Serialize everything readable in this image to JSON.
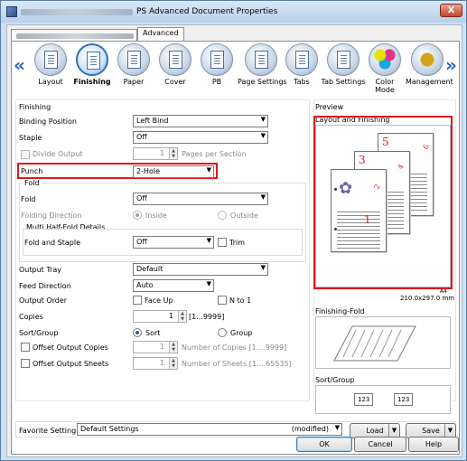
{
  "window": {
    "title": "PS Advanced Document Properties",
    "close_label": "X"
  },
  "tabs": {
    "advanced": "Advanced"
  },
  "iconbar": {
    "items": [
      {
        "label": "Layout",
        "icon": "layout-icon"
      },
      {
        "label": "Finishing",
        "icon": "finishing-icon",
        "active": true
      },
      {
        "label": "Paper",
        "icon": "paper-icon"
      },
      {
        "label": "Cover",
        "icon": "cover-icon"
      },
      {
        "label": "PB",
        "icon": "pages-per-section-icon"
      },
      {
        "label": "Page Settings",
        "icon": "page-settings-icon"
      },
      {
        "label": "Tabs",
        "icon": "tabs-icon"
      },
      {
        "label": "Tab Settings",
        "icon": "tab-settings-icon"
      },
      {
        "label": "Color Mode",
        "icon": "color-mode-icon"
      },
      {
        "label": "Management",
        "icon": "management-icon"
      }
    ]
  },
  "finishing": {
    "title": "Finishing",
    "binding_position": {
      "label": "Binding Position",
      "value": "Left Bind"
    },
    "staple": {
      "label": "Staple",
      "value": "Off"
    },
    "divide_output": {
      "label": "Divide Output",
      "value": "1",
      "unit": "Pages per Section"
    },
    "punch": {
      "label": "Punch",
      "value": "2-Hole"
    },
    "fold_group": "Fold",
    "fold": {
      "label": "Fold",
      "value": "Off"
    },
    "folding_direction": {
      "label": "Folding Direction",
      "inside": "Inside",
      "outside": "Outside"
    },
    "multi_half_fold": "Multi Half-Fold Details",
    "fold_and_staple": {
      "label": "Fold and Staple",
      "value": "Off",
      "trim": "Trim"
    },
    "output_tray": {
      "label": "Output Tray",
      "value": "Default"
    },
    "feed_direction": {
      "label": "Feed Direction",
      "value": "Auto"
    },
    "output_order": {
      "label": "Output Order",
      "face_up": "Face Up",
      "n_to_1": "N to 1"
    },
    "copies": {
      "label": "Copies",
      "value": "1",
      "range": "[1...9999]"
    },
    "sort_group": {
      "label": "Sort/Group",
      "sort": "Sort",
      "group": "Group"
    },
    "offset_copies": {
      "label": "Offset Output Copies",
      "value": "1",
      "unit": "Number of Copies [1....9999]"
    },
    "offset_sheets": {
      "label": "Offset Output Sheets",
      "value": "1",
      "unit": "Number of Sheets [1....65535]"
    }
  },
  "preview": {
    "title": "Preview",
    "subtitle": "Layout and Finishing",
    "pages": [
      "1",
      "2",
      "3",
      "4",
      "5",
      "6"
    ],
    "paper_size": "210.0x297.0 mm",
    "size_code": "A4",
    "finishing_fold": "Finishing-Fold",
    "sort_group": "Sort/Group",
    "sort_icons": [
      "123",
      "123"
    ]
  },
  "favorite": {
    "label": "Favorite Setting",
    "value": "Default Settings",
    "status": "(modified)",
    "load": "Load",
    "save": "Save"
  },
  "buttons": {
    "ok": "OK",
    "cancel": "Cancel",
    "help": "Help"
  }
}
